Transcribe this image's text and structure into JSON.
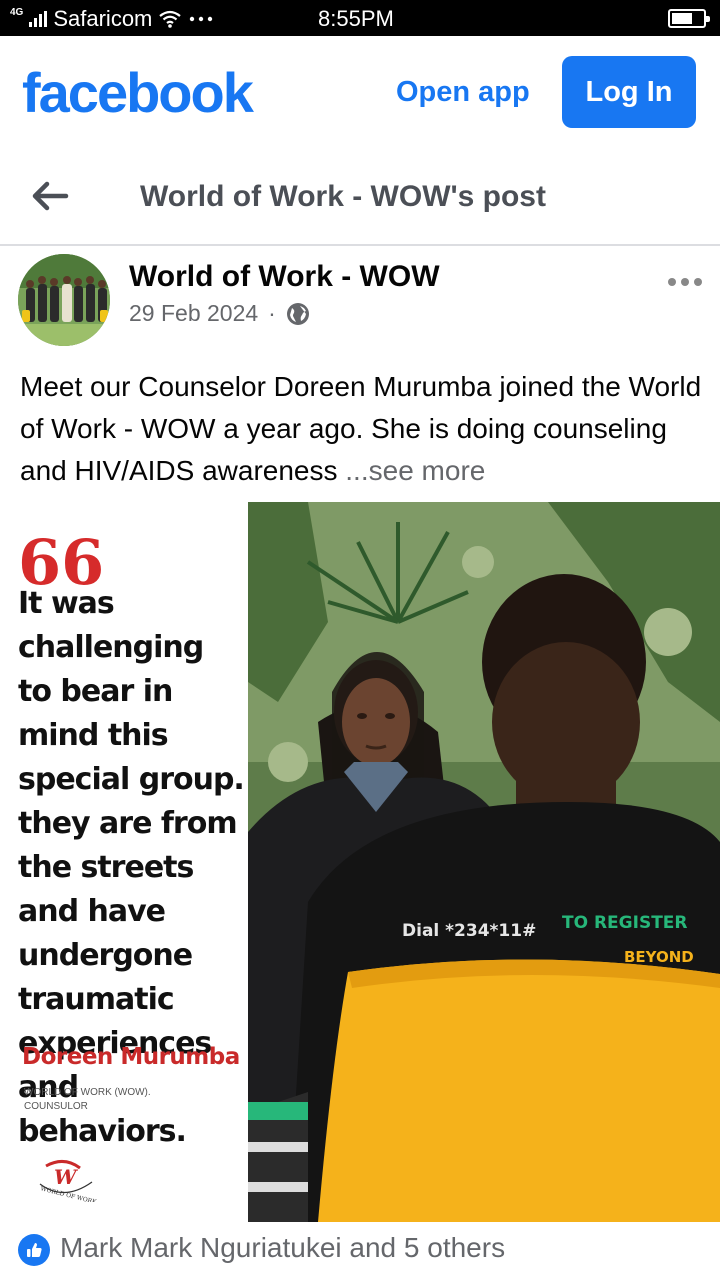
{
  "status_bar": {
    "network": "4G",
    "carrier": "Safaricom",
    "time": "8:55PM"
  },
  "header": {
    "logo": "facebook",
    "open_app": "Open app",
    "login": "Log In"
  },
  "nav": {
    "title": "World of Work - WOW's post"
  },
  "post": {
    "author": "World of Work - WOW",
    "date": "29 Feb 2024",
    "separator": "·",
    "caption": "Meet our Counselor Doreen Murumba joined the World of Work - WOW a year ago. She is doing counseling and HIV/AIDS awareness ",
    "see_more": "...see more",
    "image": {
      "quote_mark": "66",
      "quote": "It was challenging to bear in mind this special group. they are from the streets and have undergone traumatic experiences and behaviors.",
      "name": "Doreen Murumba",
      "role_line1": "WORLD OF WORK  (WOW).",
      "role_line2": "COUNSULOR",
      "logo_text": "WORLD OF WORK",
      "shirt_dial": "Dial *234*11#",
      "shirt_register": "TO REGISTER",
      "shirt_beyond": "BEYOND"
    },
    "reactions_text": "Mark Mark Nguriatukei and 5 others"
  },
  "colors": {
    "brand": "#1877f2",
    "quote_red": "#d62b2b",
    "chair": "#f5b21b"
  },
  "icons": [
    "signal-icon",
    "wifi-icon",
    "battery-icon",
    "back-arrow-icon",
    "globe-icon",
    "more-dots-icon",
    "like-icon"
  ]
}
